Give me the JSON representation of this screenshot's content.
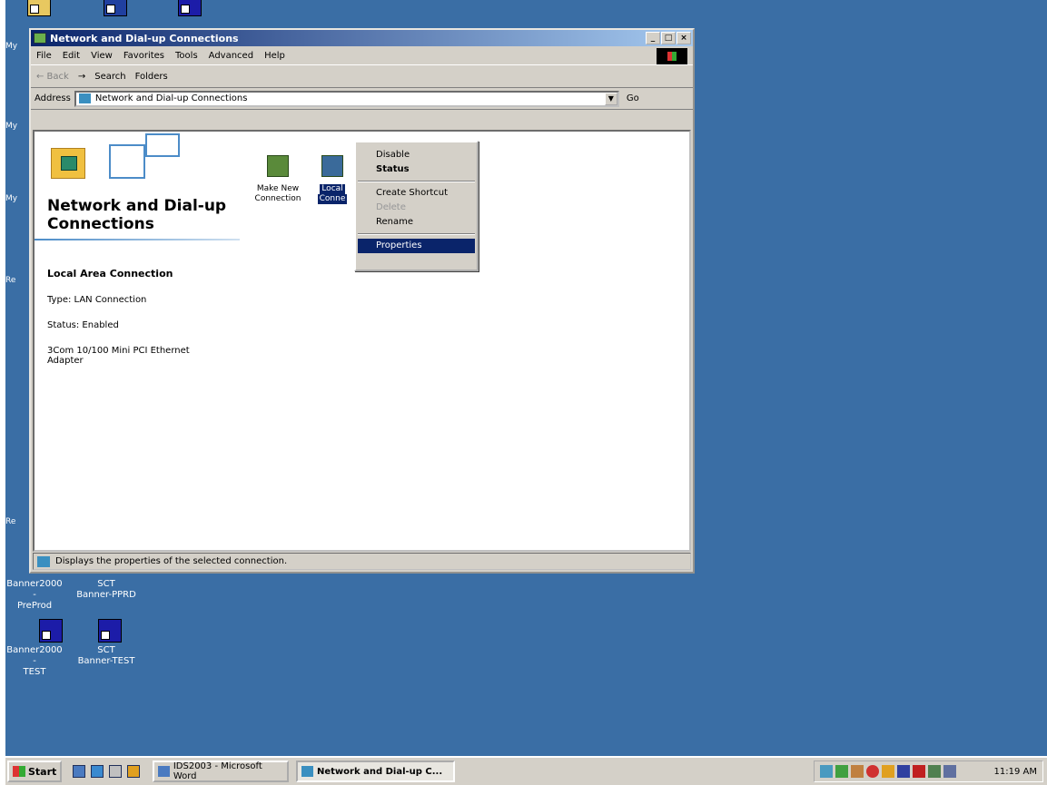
{
  "window": {
    "title": "Network and Dial-up Connections",
    "controls": [
      "_",
      "□",
      "×"
    ]
  },
  "menu": [
    "File",
    "Edit",
    "View",
    "Favorites",
    "Tools",
    "Advanced",
    "Help"
  ],
  "toolbar": {
    "back": "← Back",
    "forward": "→",
    "search": "Search",
    "folders": "Folders"
  },
  "address": {
    "label": "Address",
    "value": "Network and Dial-up Connections",
    "go": "Go"
  },
  "folder": {
    "title_line1": "Network and Dial-up",
    "title_line2": "Connections",
    "details": {
      "name": "Local Area Connection",
      "type": "Type: LAN Connection",
      "status": "Status: Enabled",
      "adapter_line1": "3Com 10/100 Mini PCI Ethernet",
      "adapter_line2": "Adapter"
    }
  },
  "items": [
    {
      "label_line1": "Make New",
      "label_line2": "Connection"
    },
    {
      "label_line1": "Local",
      "label_line2": "Conne"
    }
  ],
  "context_menu": {
    "disable": "Disable",
    "status": "Status",
    "create_shortcut": "Create Shortcut",
    "delete": "Delete",
    "rename": "Rename",
    "properties": "Properties"
  },
  "statusbar": "Displays the properties of the selected connection.",
  "desktop_icons": [
    {
      "line1": "Banner2000 -",
      "line2": "PreProd"
    },
    {
      "line1": "SCT",
      "line2": "Banner-PPRD"
    },
    {
      "line1": "Banner2000 -",
      "line2": "TEST"
    },
    {
      "line1": "SCT",
      "line2": "Banner-TEST"
    }
  ],
  "desktop_edge_labels": [
    "My",
    "My",
    "My",
    "Re",
    "Re"
  ],
  "taskbar": {
    "start": "Start",
    "tasks": [
      "IDS2003 - Microsoft Word",
      "Network and Dial-up C..."
    ],
    "clock": "11:19 AM"
  }
}
